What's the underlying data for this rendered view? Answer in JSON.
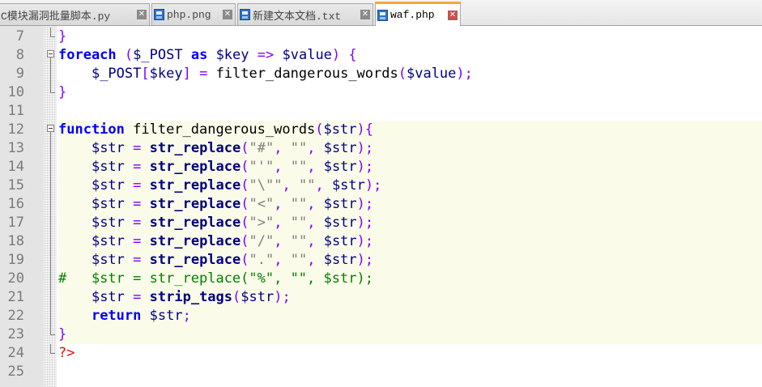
{
  "tabs": [
    {
      "label": "C模块漏洞批量脚本.py",
      "active": false,
      "partial": true
    },
    {
      "label": "php.png",
      "active": false,
      "partial": false
    },
    {
      "label": "新建文本文档.txt",
      "active": false,
      "partial": false
    },
    {
      "label": "waf.php",
      "active": true,
      "partial": false
    }
  ],
  "close_glyph": "✕",
  "lines": [
    {
      "num": "7",
      "fold": "end",
      "bg": false,
      "tokens": [
        [
          "op",
          "}"
        ]
      ]
    },
    {
      "num": "8",
      "fold": "box",
      "bg": false,
      "tokens": [
        [
          "kw",
          "foreach"
        ],
        [
          "plain",
          " "
        ],
        [
          "op",
          "("
        ],
        [
          "var",
          "$_POST"
        ],
        [
          "plain",
          " "
        ],
        [
          "kw",
          "as"
        ],
        [
          "plain",
          " "
        ],
        [
          "var",
          "$key"
        ],
        [
          "plain",
          " "
        ],
        [
          "op",
          "=>"
        ],
        [
          "plain",
          " "
        ],
        [
          "var",
          "$value"
        ],
        [
          "op",
          ")"
        ],
        [
          "plain",
          " "
        ],
        [
          "op",
          "{"
        ]
      ]
    },
    {
      "num": "9",
      "fold": "vert",
      "bg": false,
      "tokens": [
        [
          "plain",
          "    "
        ],
        [
          "var",
          "$_POST"
        ],
        [
          "op",
          "["
        ],
        [
          "var",
          "$key"
        ],
        [
          "op",
          "]"
        ],
        [
          "plain",
          " "
        ],
        [
          "op",
          "="
        ],
        [
          "plain",
          " filter_dangerous_words"
        ],
        [
          "op",
          "("
        ],
        [
          "var",
          "$value"
        ],
        [
          "op",
          ");"
        ]
      ]
    },
    {
      "num": "10",
      "fold": "end",
      "bg": false,
      "tokens": [
        [
          "op",
          "}"
        ]
      ]
    },
    {
      "num": "11",
      "fold": "",
      "bg": false,
      "tokens": []
    },
    {
      "num": "12",
      "fold": "box",
      "bg": true,
      "tokens": [
        [
          "kw",
          "function"
        ],
        [
          "plain",
          " filter_dangerous_words"
        ],
        [
          "op",
          "("
        ],
        [
          "var",
          "$str"
        ],
        [
          "op",
          "){"
        ]
      ]
    },
    {
      "num": "13",
      "fold": "vert",
      "bg": true,
      "tokens": [
        [
          "plain",
          "    "
        ],
        [
          "var",
          "$str"
        ],
        [
          "plain",
          " "
        ],
        [
          "op",
          "="
        ],
        [
          "plain",
          " "
        ],
        [
          "bfn",
          "str_replace"
        ],
        [
          "op",
          "("
        ],
        [
          "str",
          "\"#\""
        ],
        [
          "op",
          ","
        ],
        [
          "plain",
          " "
        ],
        [
          "str",
          "\"\""
        ],
        [
          "op",
          ","
        ],
        [
          "plain",
          " "
        ],
        [
          "var",
          "$str"
        ],
        [
          "op",
          ");"
        ]
      ]
    },
    {
      "num": "14",
      "fold": "vert",
      "bg": true,
      "tokens": [
        [
          "plain",
          "    "
        ],
        [
          "var",
          "$str"
        ],
        [
          "plain",
          " "
        ],
        [
          "op",
          "="
        ],
        [
          "plain",
          " "
        ],
        [
          "bfn",
          "str_replace"
        ],
        [
          "op",
          "("
        ],
        [
          "str",
          "\"'\""
        ],
        [
          "op",
          ","
        ],
        [
          "plain",
          " "
        ],
        [
          "str",
          "\"\""
        ],
        [
          "op",
          ","
        ],
        [
          "plain",
          " "
        ],
        [
          "var",
          "$str"
        ],
        [
          "op",
          ");"
        ]
      ]
    },
    {
      "num": "15",
      "fold": "vert",
      "bg": true,
      "tokens": [
        [
          "plain",
          "    "
        ],
        [
          "var",
          "$str"
        ],
        [
          "plain",
          " "
        ],
        [
          "op",
          "="
        ],
        [
          "plain",
          " "
        ],
        [
          "bfn",
          "str_replace"
        ],
        [
          "op",
          "("
        ],
        [
          "str",
          "\"\\\"\""
        ],
        [
          "op",
          ","
        ],
        [
          "plain",
          " "
        ],
        [
          "str",
          "\"\""
        ],
        [
          "op",
          ","
        ],
        [
          "plain",
          " "
        ],
        [
          "var",
          "$str"
        ],
        [
          "op",
          ");"
        ]
      ]
    },
    {
      "num": "16",
      "fold": "vert",
      "bg": true,
      "tokens": [
        [
          "plain",
          "    "
        ],
        [
          "var",
          "$str"
        ],
        [
          "plain",
          " "
        ],
        [
          "op",
          "="
        ],
        [
          "plain",
          " "
        ],
        [
          "bfn",
          "str_replace"
        ],
        [
          "op",
          "("
        ],
        [
          "str",
          "\"<\""
        ],
        [
          "op",
          ","
        ],
        [
          "plain",
          " "
        ],
        [
          "str",
          "\"\""
        ],
        [
          "op",
          ","
        ],
        [
          "plain",
          " "
        ],
        [
          "var",
          "$str"
        ],
        [
          "op",
          ");"
        ]
      ]
    },
    {
      "num": "17",
      "fold": "vert",
      "bg": true,
      "tokens": [
        [
          "plain",
          "    "
        ],
        [
          "var",
          "$str"
        ],
        [
          "plain",
          " "
        ],
        [
          "op",
          "="
        ],
        [
          "plain",
          " "
        ],
        [
          "bfn",
          "str_replace"
        ],
        [
          "op",
          "("
        ],
        [
          "str",
          "\">\""
        ],
        [
          "op",
          ","
        ],
        [
          "plain",
          " "
        ],
        [
          "str",
          "\"\""
        ],
        [
          "op",
          ","
        ],
        [
          "plain",
          " "
        ],
        [
          "var",
          "$str"
        ],
        [
          "op",
          ");"
        ]
      ]
    },
    {
      "num": "18",
      "fold": "vert",
      "bg": true,
      "tokens": [
        [
          "plain",
          "    "
        ],
        [
          "var",
          "$str"
        ],
        [
          "plain",
          " "
        ],
        [
          "op",
          "="
        ],
        [
          "plain",
          " "
        ],
        [
          "bfn",
          "str_replace"
        ],
        [
          "op",
          "("
        ],
        [
          "str",
          "\"/\""
        ],
        [
          "op",
          ","
        ],
        [
          "plain",
          " "
        ],
        [
          "str",
          "\"\""
        ],
        [
          "op",
          ","
        ],
        [
          "plain",
          " "
        ],
        [
          "var",
          "$str"
        ],
        [
          "op",
          ");"
        ]
      ]
    },
    {
      "num": "19",
      "fold": "vert",
      "bg": true,
      "tokens": [
        [
          "plain",
          "    "
        ],
        [
          "var",
          "$str"
        ],
        [
          "plain",
          " "
        ],
        [
          "op",
          "="
        ],
        [
          "plain",
          " "
        ],
        [
          "bfn",
          "str_replace"
        ],
        [
          "op",
          "("
        ],
        [
          "str",
          "\".\""
        ],
        [
          "op",
          ","
        ],
        [
          "plain",
          " "
        ],
        [
          "str",
          "\"\""
        ],
        [
          "op",
          ","
        ],
        [
          "plain",
          " "
        ],
        [
          "var",
          "$str"
        ],
        [
          "op",
          ");"
        ]
      ]
    },
    {
      "num": "20",
      "fold": "vert",
      "bg": true,
      "tokens": [
        [
          "cmt",
          "#   $str = str_replace(\"%\", \"\", $str);"
        ]
      ]
    },
    {
      "num": "21",
      "fold": "vert",
      "bg": true,
      "tokens": [
        [
          "plain",
          "    "
        ],
        [
          "var",
          "$str"
        ],
        [
          "plain",
          " "
        ],
        [
          "op",
          "="
        ],
        [
          "plain",
          " "
        ],
        [
          "bfn",
          "strip_tags"
        ],
        [
          "op",
          "("
        ],
        [
          "var",
          "$str"
        ],
        [
          "op",
          ");"
        ]
      ]
    },
    {
      "num": "22",
      "fold": "vert",
      "bg": true,
      "tokens": [
        [
          "plain",
          "    "
        ],
        [
          "kw",
          "return"
        ],
        [
          "plain",
          " "
        ],
        [
          "var",
          "$str"
        ],
        [
          "op",
          ";"
        ]
      ]
    },
    {
      "num": "23",
      "fold": "end",
      "bg": true,
      "tokens": [
        [
          "op",
          "}"
        ]
      ]
    },
    {
      "num": "24",
      "fold": "end",
      "bg": false,
      "tokens": [
        [
          "phptag",
          "?>"
        ]
      ]
    },
    {
      "num": "25",
      "fold": "",
      "bg": false,
      "tokens": []
    }
  ]
}
